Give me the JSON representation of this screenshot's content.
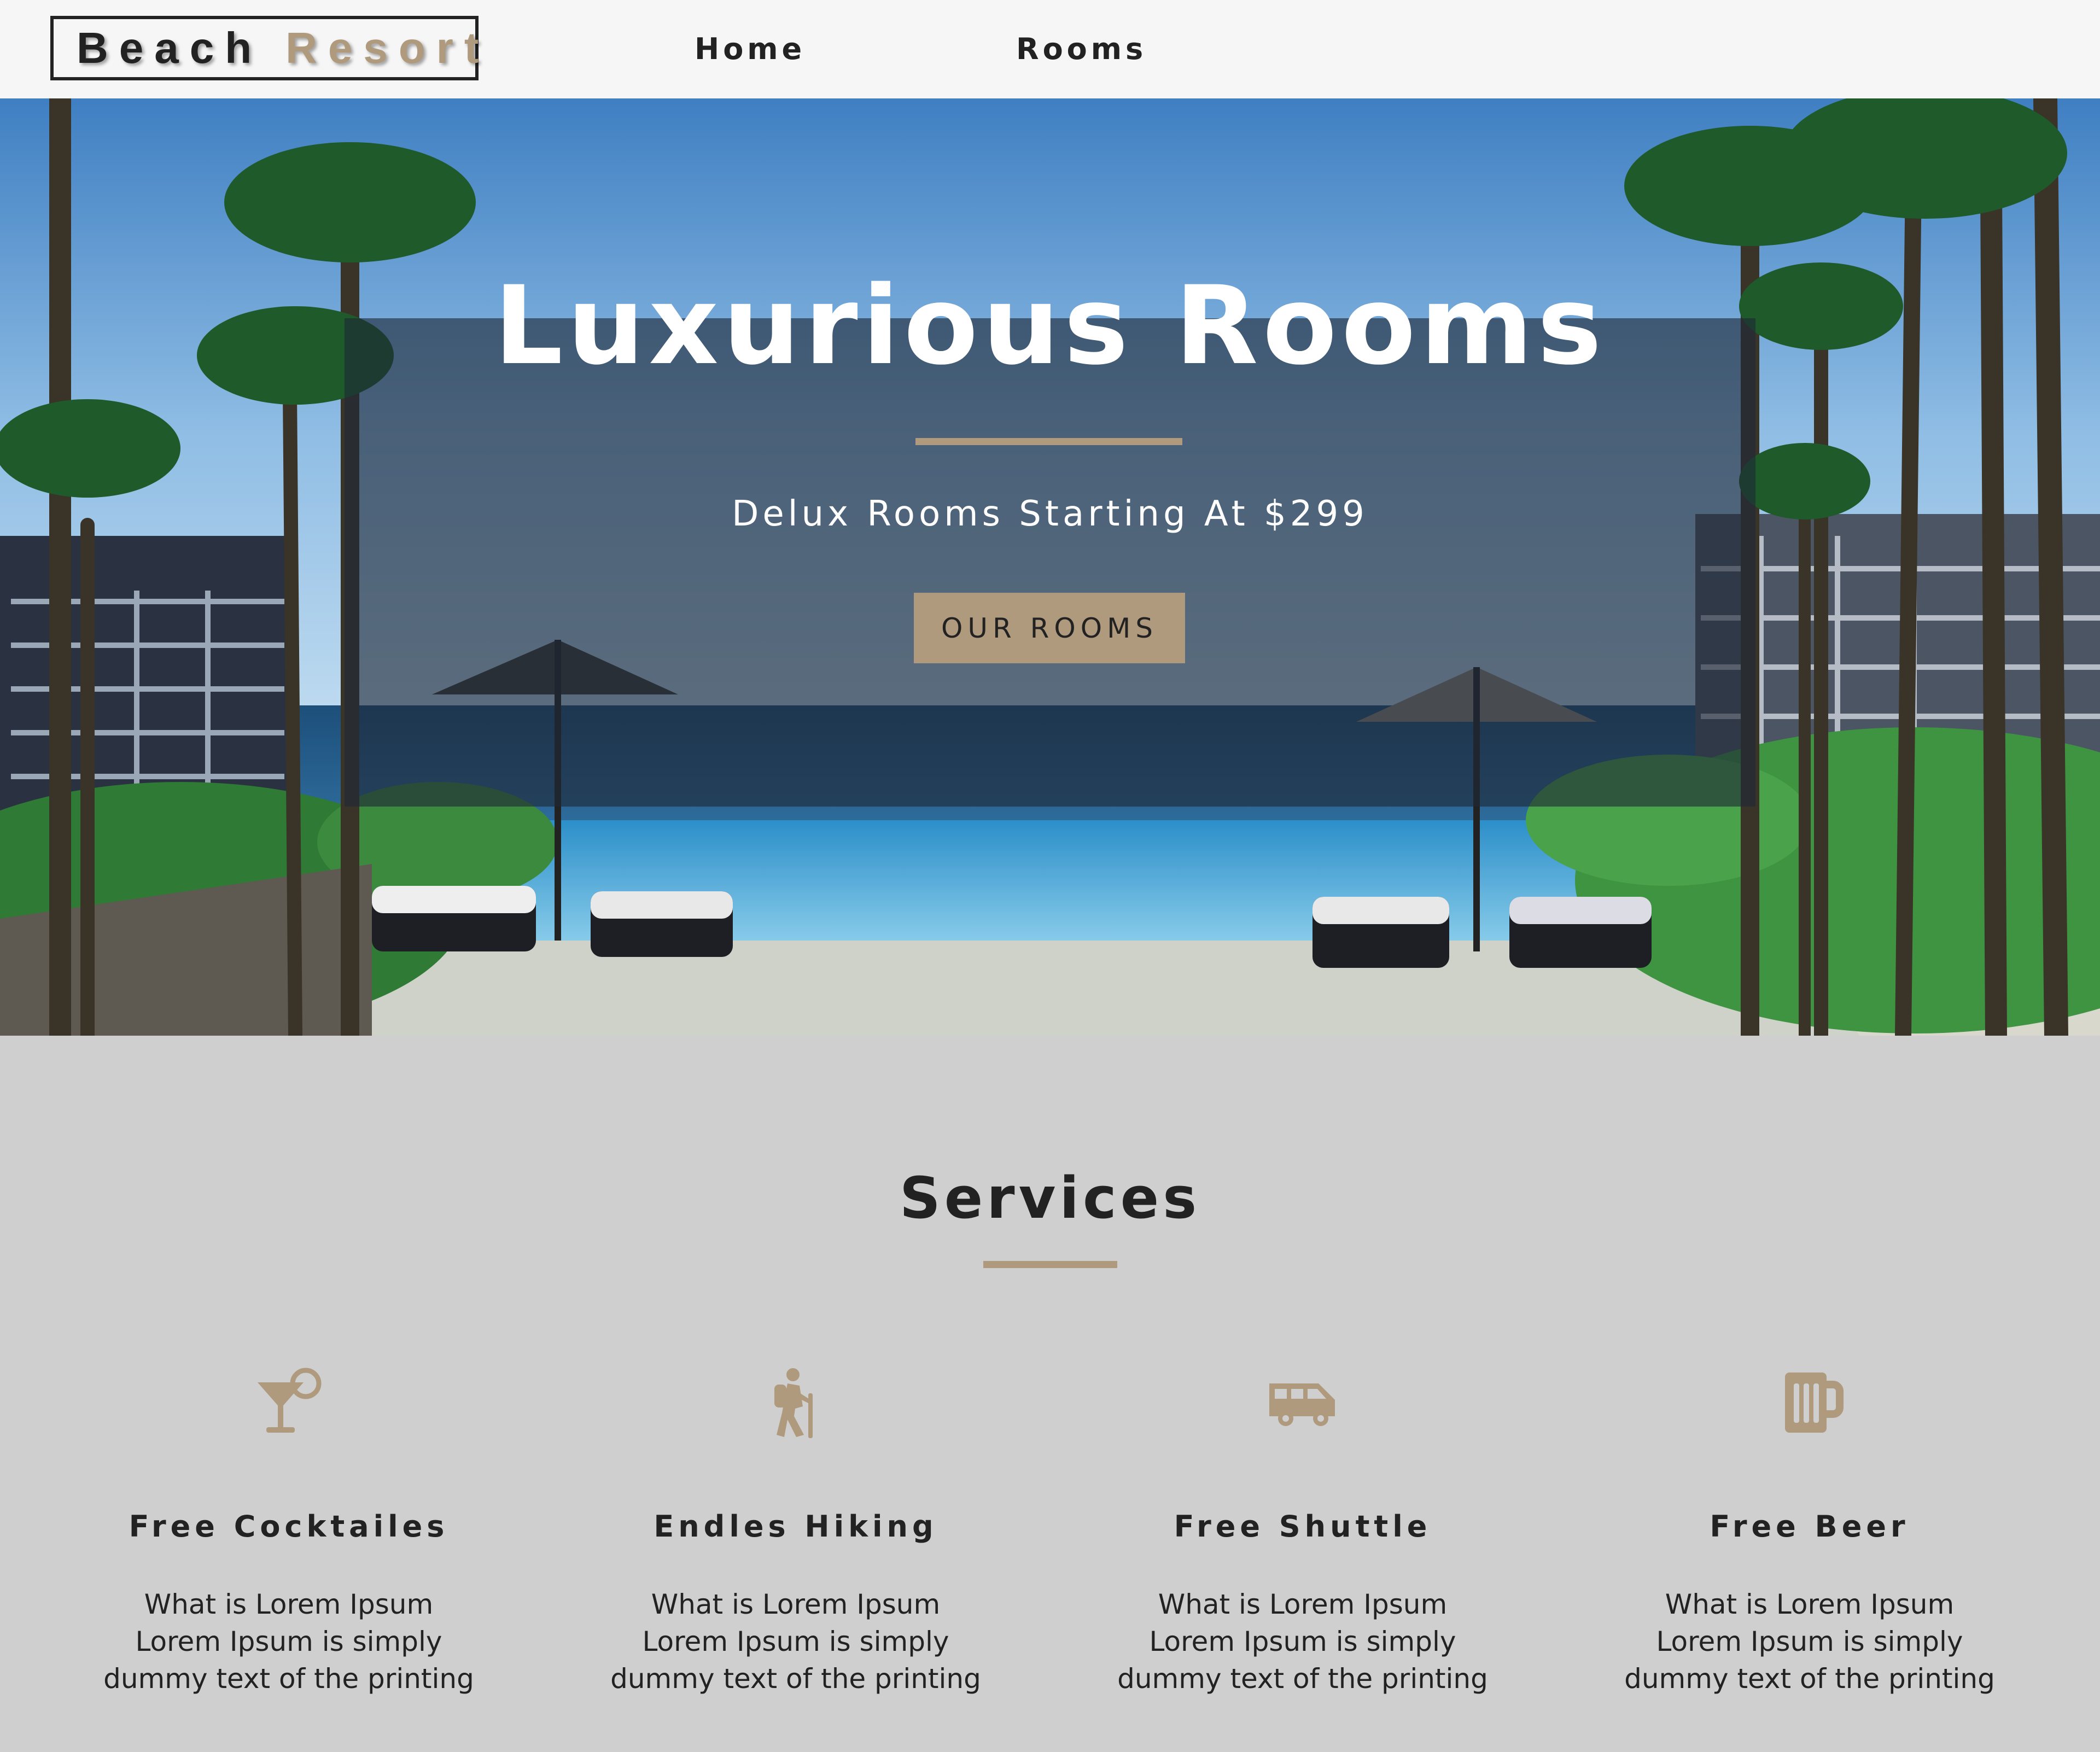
{
  "navbar": {
    "logo": {
      "word1": "Beach",
      "word2": "Resort"
    },
    "links": [
      {
        "label": "Home"
      },
      {
        "label": "Rooms"
      }
    ]
  },
  "hero": {
    "title": "Luxurious Rooms",
    "subtitle": "Delux Rooms Starting At $299",
    "button_label": "OUR ROOMS"
  },
  "services": {
    "title": "Services",
    "items": [
      {
        "icon": "cocktail-icon",
        "title": "Free Cocktailes",
        "text": "What is Lorem Ipsum Lorem Ipsum is simply dummy text of the printing"
      },
      {
        "icon": "hiking-icon",
        "title": "Endles Hiking",
        "text": "What is Lorem Ipsum Lorem Ipsum is simply dummy text of the printing"
      },
      {
        "icon": "shuttle-icon",
        "title": "Free Shuttle",
        "text": "What is Lorem Ipsum Lorem Ipsum is simply dummy text of the printing"
      },
      {
        "icon": "beer-icon",
        "title": "Free Beer",
        "text": "What is Lorem Ipsum Lorem Ipsum is simply dummy text of the printing"
      }
    ]
  },
  "colors": {
    "accent": "#af9a7d",
    "nav_background": "#f6f6f6",
    "page_background": "#cfcfcf",
    "text": "#222222"
  }
}
